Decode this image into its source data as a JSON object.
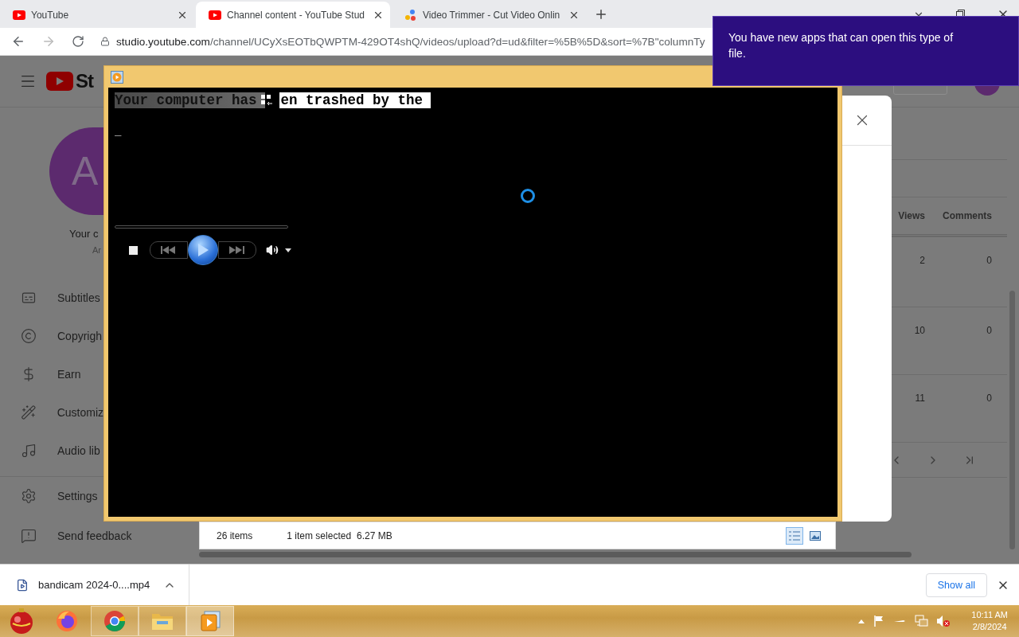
{
  "browser": {
    "tabs": [
      {
        "kind": "youtube",
        "title": "YouTube",
        "selected": false
      },
      {
        "kind": "youtube",
        "title": "Channel content - YouTube Stud",
        "selected": true
      },
      {
        "kind": "trimmer",
        "title": "Video Trimmer - Cut Video Onlin",
        "selected": false
      }
    ],
    "url_host": "studio.youtube.com",
    "url_path": "/channel/UCyXsEOTbQWPTM-429OT4shQ/videos/upload?d=ud&filter=%5B%5D&sort=%7B\"columnTy"
  },
  "studio": {
    "logo_text": "St",
    "avatar_letter": "A",
    "channel_label": "Your c",
    "channel_sub": "Ar",
    "nav": [
      {
        "kind": "subtitles",
        "label": "Subtitles"
      },
      {
        "kind": "copyright",
        "label": "Copyrigh"
      },
      {
        "kind": "earn",
        "label": "Earn"
      },
      {
        "kind": "customize",
        "label": "Customiz"
      },
      {
        "kind": "audio",
        "label": "Audio lib"
      }
    ],
    "nav_bottom": [
      {
        "kind": "settings",
        "label": "Settings"
      },
      {
        "kind": "feedback",
        "label": "Send feedback"
      }
    ],
    "table": {
      "columns": [
        "Views",
        "Comments"
      ],
      "rows": [
        [
          "2",
          "0"
        ],
        [
          "10",
          "0"
        ],
        [
          "11",
          "0"
        ]
      ]
    }
  },
  "explorer_status": {
    "items": "26 items",
    "selection": "1 item selected",
    "size": "6.27 MB"
  },
  "player": {
    "caption_dim": "Your computer has",
    "caption_bright": "en trashed by the",
    "cursor_text": "_"
  },
  "notification": "You have new apps that can open this type of file.",
  "download": {
    "file": "bandicam 2024-0....mp4",
    "show_all": "Show all"
  },
  "taskbar": {
    "apps": [
      {
        "kind": "firefox",
        "running": false,
        "selected": false
      },
      {
        "kind": "chrome",
        "running": true,
        "selected": false
      },
      {
        "kind": "explorer",
        "running": true,
        "selected": false
      },
      {
        "kind": "player",
        "running": true,
        "selected": true
      }
    ],
    "time": "10:11 AM",
    "date": "2/8/2024"
  }
}
